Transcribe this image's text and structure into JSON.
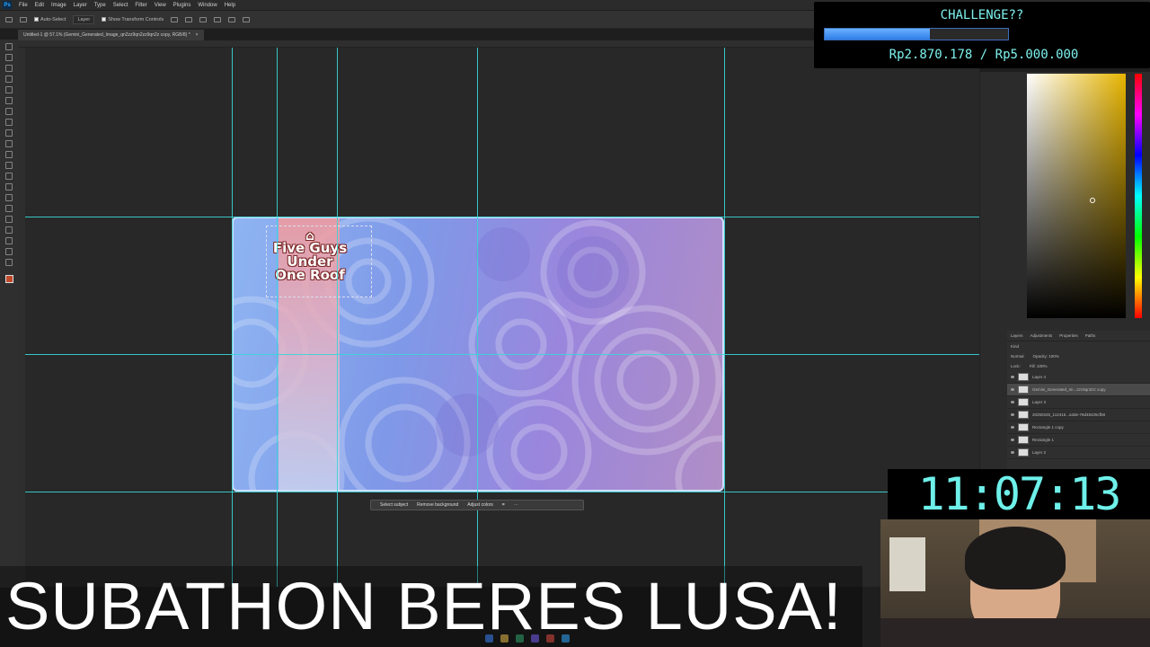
{
  "app": {
    "menus": [
      "File",
      "Edit",
      "Image",
      "Layer",
      "Type",
      "Select",
      "Filter",
      "View",
      "Plugins",
      "Window",
      "Help"
    ],
    "options": {
      "auto_select": "Auto-Select",
      "layer_select": "Layer",
      "show_transform": "Show Transform Controls"
    },
    "document_tab": "Untitled-1 @ 57.1% (Gemini_Generated_Image_qn2zz9qn2zz9qn2z copy, RGB/8) *"
  },
  "canvas": {
    "logo_lines": [
      "Five Guys",
      "Under",
      "One Roof"
    ]
  },
  "context_bar": {
    "select_subject": "Select subject",
    "remove_background": "Remove background",
    "adjust_colors": "Adjust colors"
  },
  "layers_panel": {
    "tabs": [
      "Layers",
      "Adjustments",
      "Properties",
      "Paths"
    ],
    "kind": "Kind",
    "blend": "Normal",
    "opacity": "Opacity: 100%",
    "fill": "Fill: 100%",
    "lock": "Lock:",
    "rows": [
      {
        "name": "Layer 4",
        "selected": false
      },
      {
        "name": "Gemini_Generated_Im...2zz9qn2zz copy",
        "selected": true
      },
      {
        "name": "Layer 3",
        "selected": false
      },
      {
        "name": "20250225_112415...a3de-76d48425cfb8",
        "selected": false
      },
      {
        "name": "Rectangle 1 copy",
        "selected": false
      },
      {
        "name": "Rectangle 1",
        "selected": false
      },
      {
        "name": "Layer 2",
        "selected": false
      }
    ]
  },
  "overlay": {
    "challenge_title": "CHALLENGE??",
    "challenge_amount": "Rp2.870.178 / Rp5.000.000",
    "challenge_progress": 0.574,
    "timer": "11:07:13",
    "banner": "SUBATHON BERES LUSA!"
  },
  "colors": {
    "accent_cyan": "#7df2ee",
    "guide": "#3ad6d6",
    "progress_blue": "#2f7ee8"
  }
}
